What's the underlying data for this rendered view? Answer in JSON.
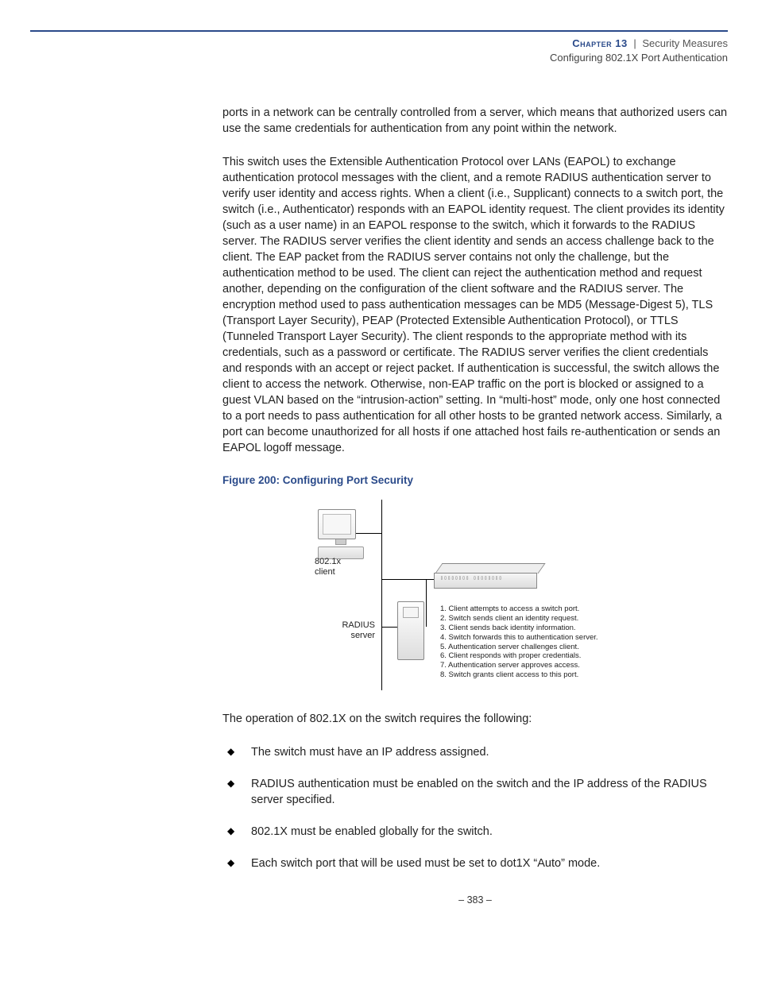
{
  "header": {
    "chapter_label": "Chapter 13",
    "section": "Security Measures",
    "subsection": "Configuring 802.1X Port Authentication"
  },
  "body": {
    "para1": "ports in a network can be centrally controlled from a server, which means that authorized users can use the same credentials for authentication from any point within the network.",
    "para2": "This switch uses the Extensible Authentication Protocol over LANs (EAPOL) to exchange authentication protocol messages with the client, and a remote RADIUS authentication server to verify user identity and access rights. When a client (i.e., Supplicant) connects to a switch port, the switch (i.e., Authenticator) responds with an EAPOL identity request. The client provides its identity (such as a user name) in an EAPOL response to the switch, which it forwards to the RADIUS server. The RADIUS server verifies the client identity and sends an access challenge back to the client. The EAP packet from the RADIUS server contains not only the challenge, but the authentication method to be used. The client can reject the authentication method and request another, depending on the configuration of the client software and the RADIUS server. The encryption method used to pass authentication messages can be MD5 (Message-Digest 5), TLS (Transport Layer Security), PEAP (Protected Extensible Authentication Protocol), or TTLS (Tunneled Transport Layer Security). The client responds to the appropriate method with its credentials, such as a password or certificate. The RADIUS server verifies the client credentials and responds with an accept or reject packet. If authentication is successful, the switch allows the client to access the network. Otherwise, non-EAP traffic on the port is blocked or assigned to a guest VLAN based on the “intrusion-action” setting. In “multi-host” mode, only one host connected to a port needs to pass authentication for all other hosts to be granted network access. Similarly, a port can become unauthorized for all hosts if one attached host fails re-authentication or sends an EAPOL logoff message.",
    "figure_caption": "Figure 200:  Configuring Port Security",
    "figure": {
      "client_label_l1": "802.1x",
      "client_label_l2": "client",
      "server_label_l1": "RADIUS",
      "server_label_l2": "server",
      "steps": [
        "1. Client attempts to access a switch port.",
        "2. Switch sends client an identity request.",
        "3. Client sends back identity information.",
        "4. Switch forwards this to authentication server.",
        "5. Authentication server challenges client.",
        "6. Client responds with proper credentials.",
        "7. Authentication server approves access.",
        "8. Switch grants client access to this port."
      ]
    },
    "para3": "The operation of 802.1X on the switch requires the following:",
    "bullets": [
      "The switch must have an IP address assigned.",
      "RADIUS authentication must be enabled on the switch and the IP address of the RADIUS server specified.",
      "802.1X must be enabled globally for the switch.",
      "Each switch port that will be used must be set to dot1X “Auto” mode."
    ]
  },
  "page_number": "–  383  –"
}
